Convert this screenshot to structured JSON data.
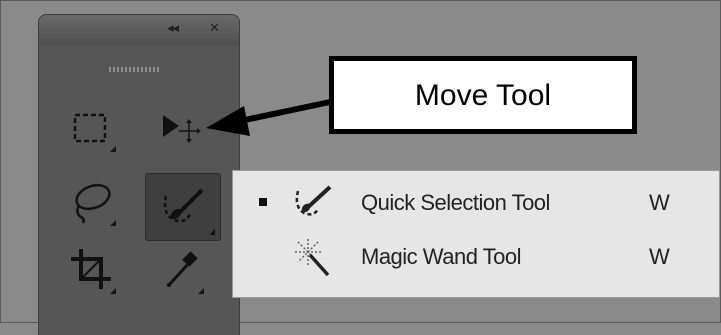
{
  "panel": {
    "collapse_glyph": "◂◂",
    "close_glyph": "✕"
  },
  "tools": [
    {
      "name": "rectangular-marquee-tool",
      "icon": "marquee-icon",
      "has_submenu": true
    },
    {
      "name": "move-tool",
      "icon": "move-arrow-icon",
      "has_submenu": false
    },
    {
      "name": "lasso-tool",
      "icon": "lasso-icon",
      "has_submenu": true
    },
    {
      "name": "quick-selection-tool",
      "icon": "quick-selection-brush-icon",
      "has_submenu": true,
      "active": true
    },
    {
      "name": "crop-tool",
      "icon": "crop-icon",
      "has_submenu": true
    },
    {
      "name": "eyedropper-tool",
      "icon": "eyedropper-icon",
      "has_submenu": true
    }
  ],
  "flyout": {
    "items": [
      {
        "label": "Quick Selection Tool",
        "shortcut": "W",
        "selected": true,
        "icon": "quick-selection-brush-icon"
      },
      {
        "label": "Magic Wand Tool",
        "shortcut": "W",
        "selected": false,
        "icon": "magic-wand-icon"
      }
    ]
  },
  "callout": {
    "text": "Move Tool"
  },
  "colors": {
    "background": "#8a8a8a",
    "panel": "#565656",
    "active_tool": "#3f3f3f",
    "flyout": "#e6e6e6",
    "callout_border": "#000000"
  }
}
